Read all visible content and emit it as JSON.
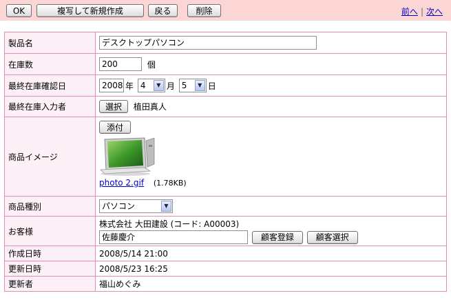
{
  "toolbar": {
    "ok_label": "OK",
    "copy_new_label": "複写して新規作成",
    "back_label": "戻る",
    "delete_label": "削除",
    "prev_label": "前へ",
    "next_label": "次へ",
    "separator": "|"
  },
  "form": {
    "product_name": {
      "label": "製品名",
      "value": "デスクトップパソコン"
    },
    "stock": {
      "label": "在庫数",
      "value": "200",
      "unit": "個"
    },
    "last_check_date": {
      "label": "最終在庫確認日",
      "year": "2008",
      "year_unit": "年",
      "month": "4",
      "month_unit": "月",
      "day": "5",
      "day_unit": "日"
    },
    "last_input_user": {
      "label": "最終在庫入力者",
      "select_button": "選択",
      "value": "植田真人"
    },
    "product_image": {
      "label": "商品イメージ",
      "attach_button": "添付",
      "file_name": "photo 2.gif",
      "file_size": "(1.78KB)"
    },
    "product_type": {
      "label": "商品種別",
      "value": "パソコン"
    },
    "customer": {
      "label": "お客様",
      "company": "株式会社 大田建設 (コード: A00003)",
      "person": "佐藤慶介",
      "register_button": "顧客登録",
      "select_button": "顧客選択"
    },
    "created_at": {
      "label": "作成日時",
      "value": "2008/5/14 21:00"
    },
    "updated_at": {
      "label": "更新日時",
      "value": "2008/5/23 16:25"
    },
    "updated_by": {
      "label": "更新者",
      "value": "福山めぐみ"
    }
  },
  "colors": {
    "toolbar_bg": "#fcd5d5",
    "label_bg": "#fdf1f7",
    "border": "#e38cb6",
    "link": "#0000cc"
  }
}
